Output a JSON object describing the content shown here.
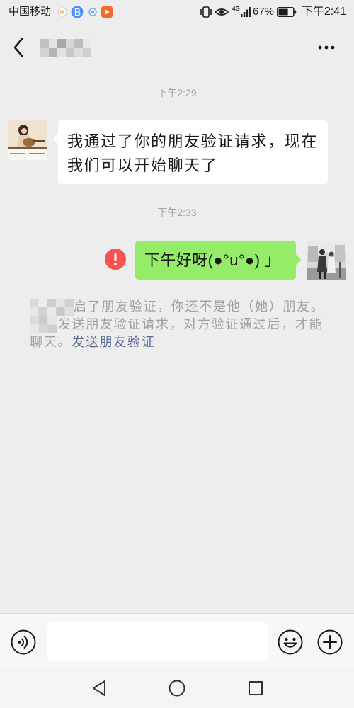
{
  "status_bar": {
    "carrier": "中国移动",
    "network": "4G",
    "battery_level": "67%",
    "time": "下午2:41",
    "left_icons": [
      "hand-notification-icon",
      "blue-app-icon",
      "blue-dot-app-icon",
      "video-play-icon"
    ],
    "right_icons": [
      "vibrate-icon",
      "eye-icon",
      "signal-icon",
      "battery-icon"
    ]
  },
  "header": {
    "back_icon": "chevron-left-icon",
    "more_icon": "more-dots-icon"
  },
  "chat": {
    "timestamp_1": "下午2:29",
    "incoming_message": "我通过了你的朋友验证请求，现在我们可以开始聊天了",
    "timestamp_2": "下午2:33",
    "outgoing_message": {
      "text": "下午好呀(●°u°●) 」",
      "send_failed": true,
      "status_icon": "exclamation-circle-icon"
    },
    "system_notice": {
      "line_1": "启了朋友验证，你还不是他（她）朋友。",
      "line_2": "发送朋友验证请求，对方验证通过后，才能",
      "line_3": "聊天。",
      "link": "发送朋友验证"
    }
  },
  "input_bar": {
    "input_value": "",
    "voice_icon": "voice-icon",
    "emoji_icon": "emoji-icon",
    "plus_icon": "plus-circle-icon"
  },
  "nav_bar": {
    "icons": [
      "back-triangle-icon",
      "home-circle-icon",
      "recents-square-icon"
    ]
  },
  "colors": {
    "background": "#ededed",
    "outgoing_bubble": "#95ec69",
    "incoming_bubble": "#ffffff",
    "send_failed": "#fa5151",
    "link": "#576b95",
    "timestamp": "#a3a3a3",
    "notice_text": "#a0a0a0"
  }
}
